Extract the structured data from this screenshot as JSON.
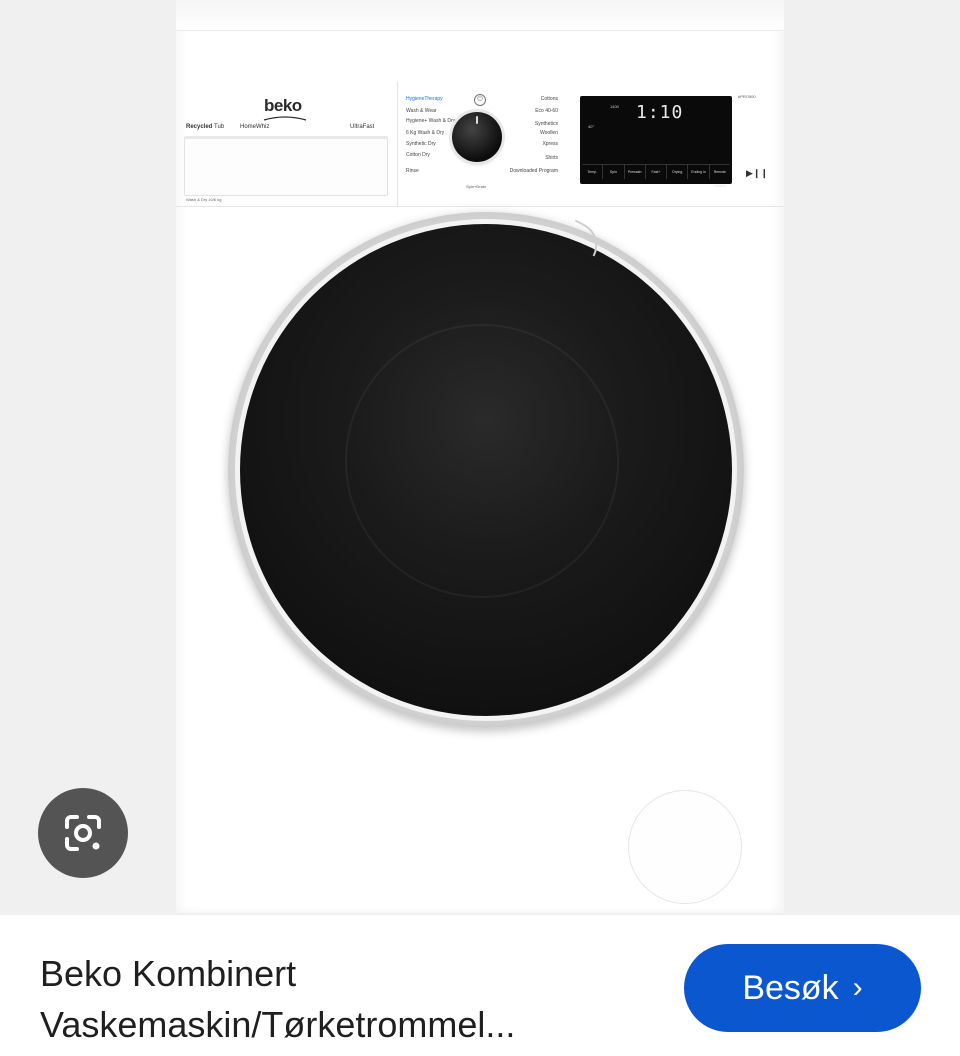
{
  "product": {
    "brand_logo": "beko",
    "badges": {
      "recycled": "Recycled",
      "recycled_tub": "Tub",
      "homewhiz": "HomeWhiz",
      "ultrafast": "UltraFast"
    },
    "capacity_label": "Wash & Dry 10/6 kg",
    "model_label": "bPRO500",
    "programs_left": [
      "HygieneTherapy",
      "Wash & Wear",
      "Hygiene+ Wash & Dry",
      "6 Kg Wash & Dry",
      "Synthetic Dry",
      "Cotton Dry",
      "Rinse"
    ],
    "programs_right": [
      "Cottons",
      "Eco 40-60",
      "Synthetics",
      "Woollen",
      "Xpress",
      "Shirts",
      "Downloaded Program"
    ],
    "spin_drain_label": "Spin+Drain",
    "display": {
      "time": "1:10",
      "temp_small": "40°",
      "speed_small": "1400",
      "buttons": [
        "Temp.",
        "Spin",
        "Prewash",
        "Fast+",
        "Drying",
        "Ending in",
        "Remote Control"
      ]
    }
  },
  "caption": {
    "line1": "Beko Kombinert",
    "line2": "Vaskemaskin/Tørketrommel..."
  },
  "visit_button": {
    "label": "Besøk",
    "chevron": "›"
  },
  "colors": {
    "button_blue": "#0b57d0",
    "highlight_blue": "#1a73e8",
    "lens_overlay": "#464646"
  },
  "icons": [
    "google-lens-icon",
    "power-icon",
    "start-pause-icon",
    "chevron-right-icon"
  ]
}
